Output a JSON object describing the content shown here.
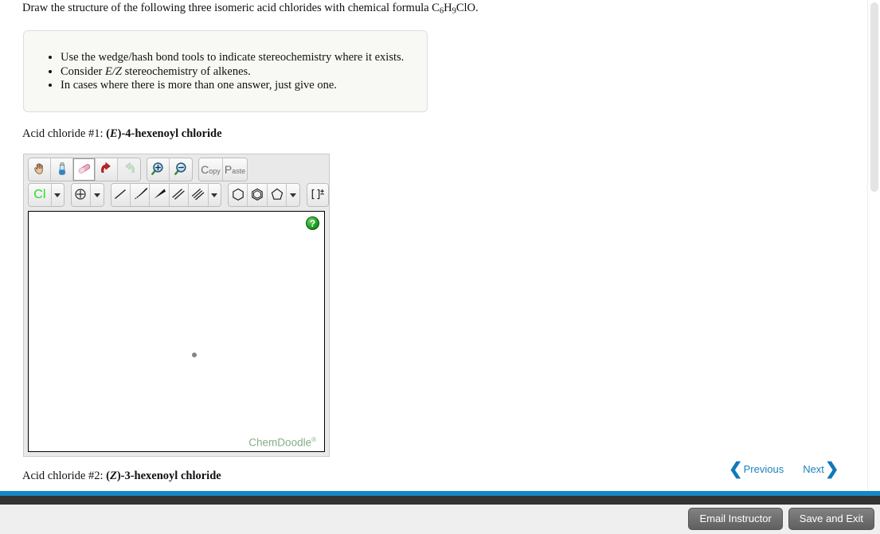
{
  "prompt": {
    "text_before": "Draw the structure of the following three isomeric acid chlorides with chemical formula C",
    "sub1": "6",
    "mid1": "H",
    "sub2": "9",
    "text_after": "ClO."
  },
  "instructions": {
    "items": [
      "Use the wedge/hash bond tools to indicate stereochemistry where it exists.",
      "Consider E/Z stereochemistry of alkenes.",
      "In cases where there is more than one answer, just give one."
    ],
    "item2_prefix": "Consider ",
    "item2_italic": "E/Z",
    "item2_suffix": " stereochemistry of alkenes."
  },
  "structures": [
    {
      "prefix": "Acid chloride #1: ",
      "stereo": "E",
      "name_rest": ")-4-hexenoyl chloride",
      "open_paren": "(",
      "close_paren": ")"
    },
    {
      "prefix": "Acid chloride #2: ",
      "stereo": "Z",
      "name_rest": ")-3-hexenoyl chloride",
      "open_paren": "(",
      "close_paren": ")"
    }
  ],
  "sketcher": {
    "toolbar_row1": [
      {
        "name": "pan-hand-icon",
        "label": "Hand",
        "selected": false,
        "disabled": false
      },
      {
        "name": "eyedropper-icon",
        "label": "Eyedropper",
        "selected": false,
        "disabled": false
      },
      {
        "name": "eraser-icon",
        "label": "Eraser",
        "selected": true,
        "disabled": false
      },
      {
        "name": "undo-icon",
        "label": "Undo",
        "selected": false,
        "disabled": false
      },
      {
        "name": "redo-icon",
        "label": "Redo",
        "selected": false,
        "disabled": true
      },
      {
        "name": "zoom-in-icon",
        "label": "Zoom In",
        "selected": false,
        "disabled": false
      },
      {
        "name": "zoom-out-icon",
        "label": "Zoom Out",
        "selected": false,
        "disabled": false
      }
    ],
    "copy_button": {
      "big": "C",
      "small": "opy"
    },
    "paste_button": {
      "big": "P",
      "small": "aste"
    },
    "element_button": {
      "label": "Cl",
      "color": "#22dd22"
    },
    "charge_button": {
      "label": "+"
    },
    "bond_tools": [
      {
        "name": "single-bond-icon",
        "label": "Single Bond"
      },
      {
        "name": "hash-wedge-bond-icon",
        "label": "Hash Wedge Bond"
      },
      {
        "name": "solid-wedge-bond-icon",
        "label": "Solid Wedge Bond"
      },
      {
        "name": "double-bond-icon",
        "label": "Double Bond"
      },
      {
        "name": "triple-bond-icon",
        "label": "Triple Bond"
      }
    ],
    "ring_tools": [
      {
        "name": "cyclohexane-ring-icon",
        "label": "Cyclohexane"
      },
      {
        "name": "benzene-ring-icon",
        "label": "Benzene"
      },
      {
        "name": "cyclopentane-ring-icon",
        "label": "Cyclopentane"
      }
    ],
    "bracket_tool": {
      "label": "[ ]",
      "sup": "±"
    },
    "help_button": {
      "label": "?"
    },
    "watermark": {
      "text": "ChemDoodle",
      "sup": "®"
    }
  },
  "navigation": {
    "previous": "Previous",
    "next": "Next",
    "chevron_left": "❮",
    "chevron_right": "❯"
  },
  "footer": {
    "email_instructor": "Email Instructor",
    "save_and_exit": "Save and Exit"
  },
  "colors": {
    "accent_blue": "#1487c8",
    "link_blue": "#1f80c0",
    "footer_dark": "#333333",
    "element_green": "#22dd22",
    "watermark_green": "#86ad86"
  }
}
